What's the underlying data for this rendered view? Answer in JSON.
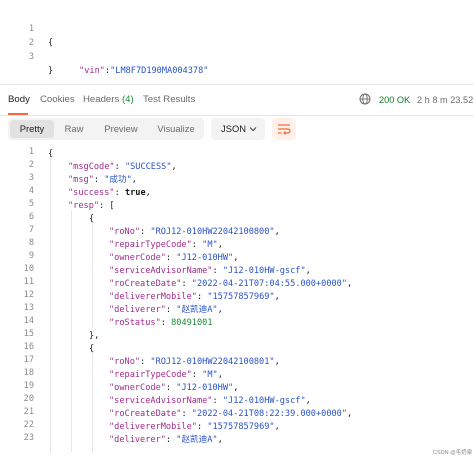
{
  "request_body": {
    "lines": [
      {
        "num": "1",
        "text": "{"
      },
      {
        "num": "2",
        "key": "\"vin\"",
        "sep": ":",
        "value": "\"LM8F7D190MA004378\""
      },
      {
        "num": "3",
        "text": "}"
      }
    ]
  },
  "response_tabs": {
    "body": "Body",
    "cookies": "Cookies",
    "headers": "Headers",
    "headers_count": "(4)",
    "test_results": "Test Results"
  },
  "response_status": {
    "status": "200 OK",
    "time": "2 h 8 m 23.52 s"
  },
  "toolbar": {
    "pretty": "Pretty",
    "raw": "Raw",
    "preview": "Preview",
    "visualize": "Visualize",
    "format": "JSON"
  },
  "response_body": {
    "line_numbers": [
      "1",
      "2",
      "3",
      "4",
      "5",
      "6",
      "7",
      "8",
      "9",
      "10",
      "11",
      "12",
      "13",
      "14",
      "15",
      "16",
      "17",
      "18",
      "19",
      "20",
      "21",
      "22",
      "23"
    ],
    "l2": {
      "k": "\"msgCode\"",
      "v": "\"SUCCESS\"",
      "e": ","
    },
    "l3": {
      "k": "\"msg\"",
      "v": "\"成功\"",
      "e": ","
    },
    "l4": {
      "k": "\"success\"",
      "v": "true",
      "e": ","
    },
    "l5": {
      "k": "\"resp\"",
      "v": "[",
      "e": ""
    },
    "r1": {
      "roNo": {
        "k": "\"roNo\"",
        "v": "\"ROJ12-010HW22042100800\"",
        "e": ","
      },
      "repairTypeCode": {
        "k": "\"repairTypeCode\"",
        "v": "\"M\"",
        "e": ","
      },
      "ownerCode": {
        "k": "\"ownerCode\"",
        "v": "\"J12-010HW\"",
        "e": ","
      },
      "serviceAdvisorName": {
        "k": "\"serviceAdvisorName\"",
        "v": "\"J12-010HW-gscf\"",
        "e": ","
      },
      "roCreateDate": {
        "k": "\"roCreateDate\"",
        "v": "\"2022-04-21T07:04:55.000+0000\"",
        "e": ","
      },
      "delivererMobile": {
        "k": "\"delivererMobile\"",
        "v": "\"15757857969\"",
        "e": ","
      },
      "deliverer": {
        "k": "\"deliverer\"",
        "v": "\"赵凯迪A\"",
        "e": ","
      },
      "roStatus": {
        "k": "\"roStatus\"",
        "v": "80491001",
        "e": ""
      }
    },
    "r2": {
      "roNo": {
        "k": "\"roNo\"",
        "v": "\"ROJ12-010HW22042100801\"",
        "e": ","
      },
      "repairTypeCode": {
        "k": "\"repairTypeCode\"",
        "v": "\"M\"",
        "e": ","
      },
      "ownerCode": {
        "k": "\"ownerCode\"",
        "v": "\"J12-010HW\"",
        "e": ","
      },
      "serviceAdvisorName": {
        "k": "\"serviceAdvisorName\"",
        "v": "\"J12-010HW-gscf\"",
        "e": ","
      },
      "roCreateDate": {
        "k": "\"roCreateDate\"",
        "v": "\"2022-04-21T08:22:39.000+0000\"",
        "e": ","
      },
      "delivererMobile": {
        "k": "\"delivererMobile\"",
        "v": "\"15757857969\"",
        "e": ","
      },
      "deliverer": {
        "k": "\"deliverer\"",
        "v": "\"赵凯迪A\"",
        "e": ","
      }
    },
    "brace_open": "{",
    "brace_close": "}",
    "brace_close_comma": "},",
    "colon": ": "
  },
  "watermark": "CSDN @毛奶泉"
}
